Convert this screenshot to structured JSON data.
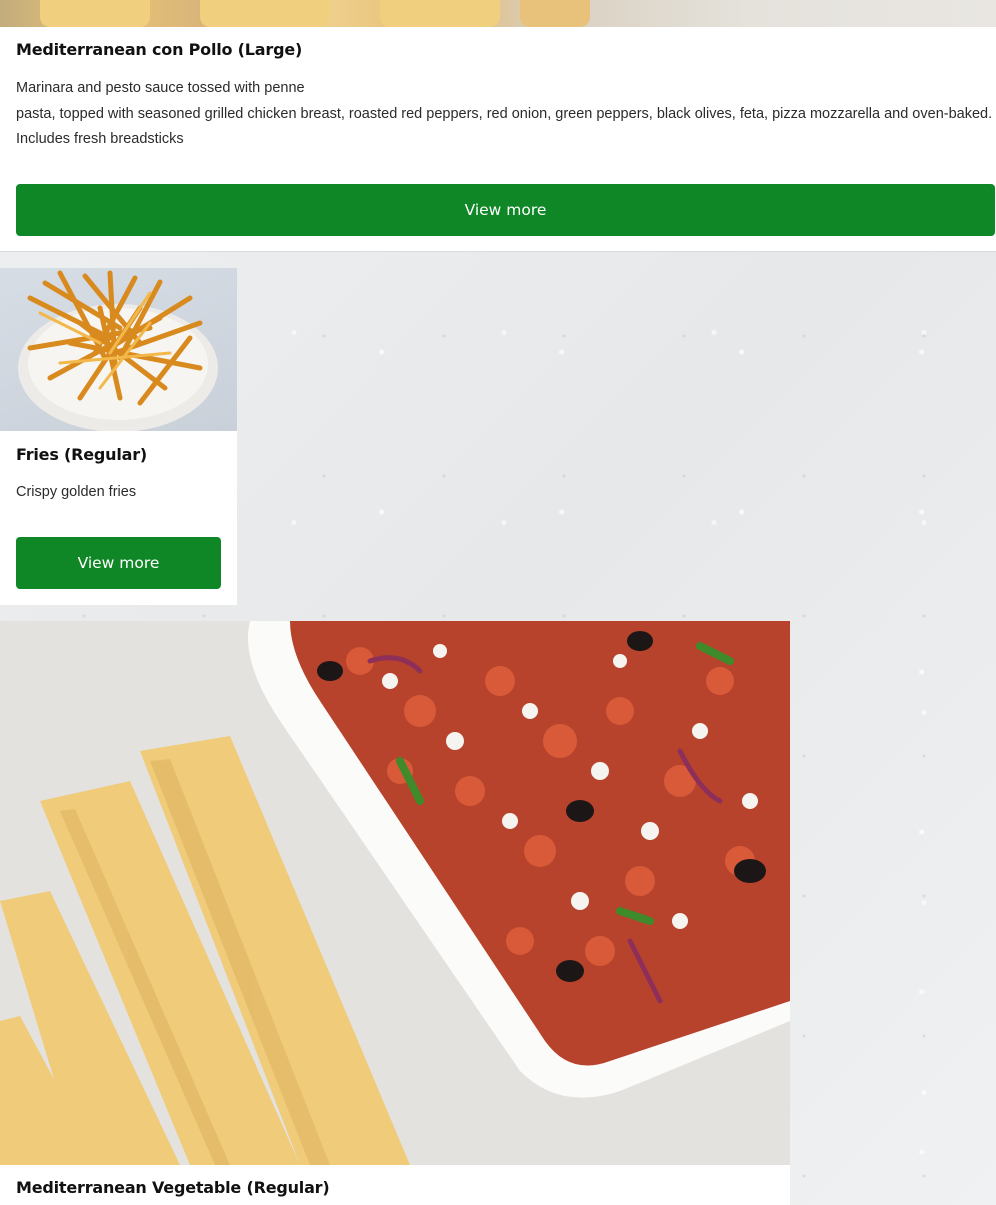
{
  "items": [
    {
      "title": "Mediterranean con Pollo (Large)",
      "description_line1": "Marinara and pesto sauce tossed with penne",
      "description_line2": "pasta, topped with seasoned grilled chicken breast, roasted red peppers, red onion, green peppers, black olives, feta, pizza mozzarella and oven-baked. Includes fresh breadsticks",
      "button_label": "View more"
    },
    {
      "title": "Fries (Regular)",
      "description": "Crispy golden fries",
      "button_label": "View more"
    },
    {
      "title": "Mediterranean Vegetable (Regular)"
    }
  ],
  "colors": {
    "button": "#108726",
    "button_text": "#ffffff",
    "page_background": "#eceef0"
  }
}
